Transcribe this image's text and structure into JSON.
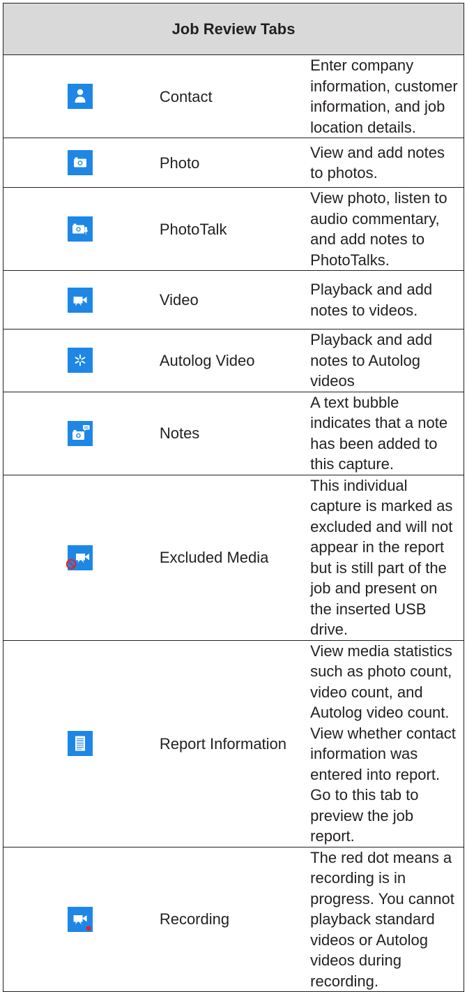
{
  "header": {
    "title": "Job Review Tabs"
  },
  "rows": [
    {
      "name": "Contact",
      "icon": "person-icon",
      "description": "Enter company information, customer information, and job location details."
    },
    {
      "name": "Photo",
      "icon": "camera-icon",
      "description": "View and add notes to photos."
    },
    {
      "name": "PhotoTalk",
      "icon": "camera-mic-icon",
      "description": "View photo, listen to audio commentary, and add notes to PhotoTalks."
    },
    {
      "name": "Video",
      "icon": "video-camera-icon",
      "description": "Playback and add notes to videos."
    },
    {
      "name": "Autolog Video",
      "icon": "autolog-asterisk-icon",
      "description": "Playback and add notes to Autolog videos"
    },
    {
      "name": "Notes",
      "icon": "camera-note-bubble-icon",
      "description": "A text bubble indicates that a note has been added to this capture."
    },
    {
      "name": "Excluded Media",
      "icon": "excluded-video-icon",
      "description": "This individual capture is marked as excluded and will not appear in the report but is still part of the job and present on the inserted USB drive."
    },
    {
      "name": "Report Information",
      "icon": "report-document-icon",
      "description": "View media statistics such as photo count, video count, and Autolog video count. View whether contact information was entered into report. Go to this tab to preview the job report."
    },
    {
      "name": "Recording",
      "icon": "recording-video-icon",
      "description": "The red dot means a recording is in progress. You cannot playback standard videos or Autolog videos during recording."
    }
  ],
  "colors": {
    "icon_blue": "#1e87e5",
    "header_gray": "#d9d9d9",
    "record_red": "#e5202e"
  }
}
